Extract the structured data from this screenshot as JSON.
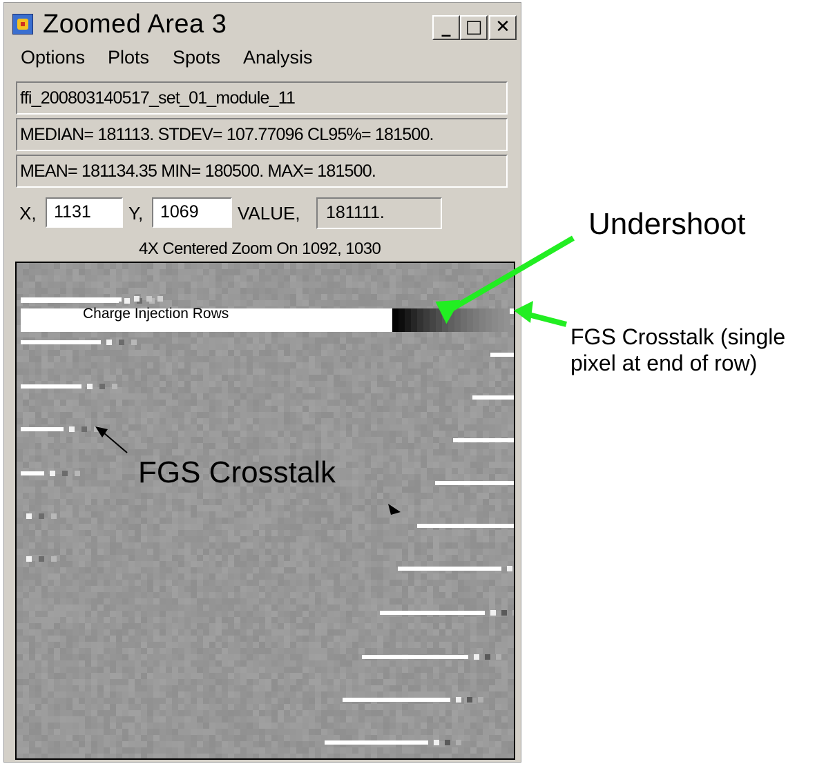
{
  "window": {
    "title": "Zoomed Area  3",
    "controls": {
      "minimize": "_",
      "maximize": "□",
      "close": "✕"
    },
    "icon": "app-icon"
  },
  "menu": [
    "Options",
    "Plots",
    "Spots",
    "Analysis"
  ],
  "info": {
    "filename": "ffi_200803140517_set_01_module_11",
    "stats1": "MEDIAN= 181113. STDEV= 107.77096 CL95%= 181500.",
    "stats2": "MEAN= 181134.35 MIN= 180500. MAX= 181500."
  },
  "coords": {
    "x_label": "X,",
    "x_value": "1131",
    "y_label": "Y,",
    "y_value": "1069",
    "value_label": "VALUE,",
    "value": "181111."
  },
  "zoom_caption": "4X Centered Zoom On  1092, 1030",
  "image_label": "Charge Injection Rows",
  "annotations": {
    "undershoot": "Undershoot",
    "fgs_single_line1": "FGS Crosstalk (single",
    "fgs_single_line2": "pixel at end of row)",
    "fgs_crosstalk": "FGS Crosstalk"
  },
  "colors": {
    "arrow_green": "#22ee22",
    "window_bg": "#d4d0c8",
    "image_bg": "#9f9f9f"
  }
}
